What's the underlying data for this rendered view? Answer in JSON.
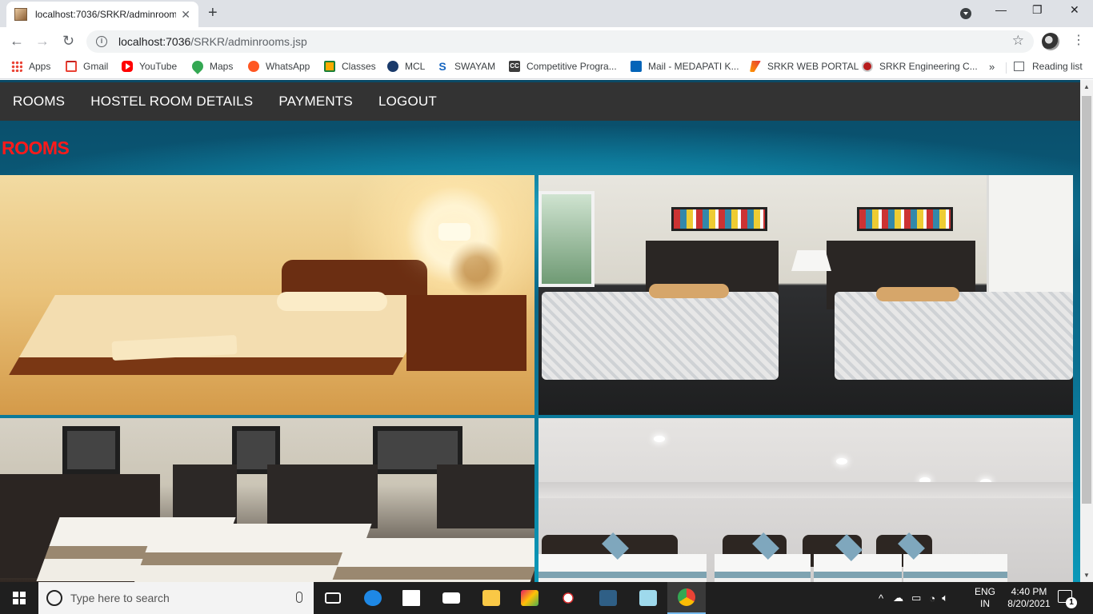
{
  "browser": {
    "tab_title": "localhost:7036/SRKR/adminroom",
    "url_host": "localhost:7036",
    "url_path": "/SRKR/adminrooms.jsp",
    "tab_close": "✕",
    "new_tab": "+",
    "back": "←",
    "forward": "→",
    "reload": "↻",
    "star": "☆",
    "menu": "⋮",
    "minimize": "—",
    "restore": "❐",
    "close": "✕"
  },
  "bookmarks": {
    "items": [
      {
        "label": "Apps",
        "icon": "apps-icon"
      },
      {
        "label": "Gmail",
        "icon": "gmail-icon"
      },
      {
        "label": "YouTube",
        "icon": "youtube-icon"
      },
      {
        "label": "Maps",
        "icon": "maps-icon"
      },
      {
        "label": "WhatsApp",
        "icon": "whatsapp-icon"
      },
      {
        "label": "Classes",
        "icon": "classroom-icon"
      },
      {
        "label": "MCL",
        "icon": "mcl-icon"
      },
      {
        "label": "SWAYAM",
        "icon": "swayam-icon"
      },
      {
        "label": "Competitive Progra...",
        "icon": "cc-icon"
      },
      {
        "label": "Mail - MEDAPATI K...",
        "icon": "outlook-icon"
      },
      {
        "label": "SRKR WEB PORTAL",
        "icon": "srkr-portal-icon"
      },
      {
        "label": "SRKR Engineering C...",
        "icon": "srkr-college-icon"
      }
    ],
    "overflow": "»",
    "reading_list": "Reading list"
  },
  "nav": {
    "rooms": "ROOMS",
    "hostel_room_details": "HOSTEL ROOM DETAILS",
    "payments": "PAYMENTS",
    "logout": "LOGOUT"
  },
  "page": {
    "heading": "ROOMS"
  },
  "taskbar": {
    "search_placeholder": "Type here to search",
    "lang_line1": "ENG",
    "lang_line2": "IN",
    "time": "4:40 PM",
    "date": "8/20/2021",
    "notification_count": "1",
    "tray_chevron": "^"
  },
  "colors": {
    "heading": "#ff1a1a",
    "navbar": "#333333",
    "page_bg": "#0b6f90"
  }
}
